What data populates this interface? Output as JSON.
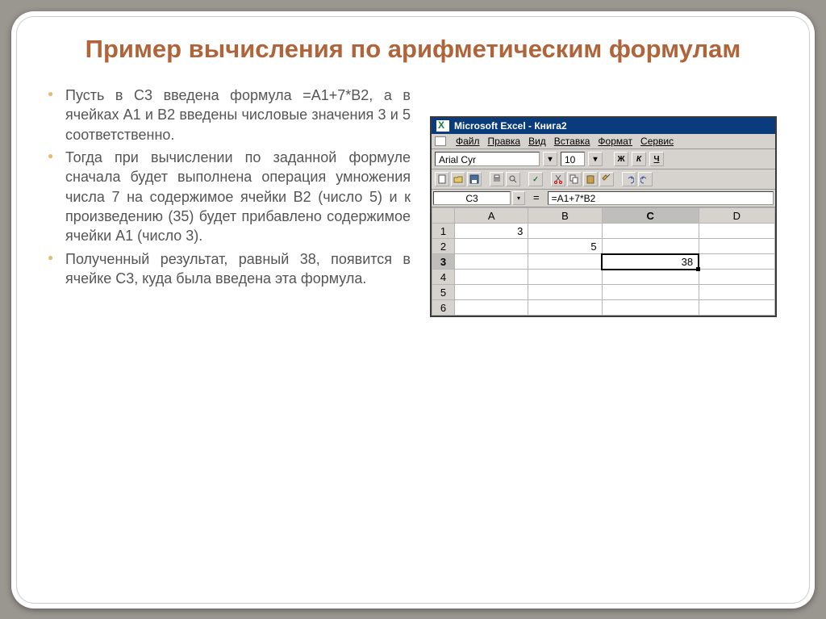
{
  "title": "Пример вычисления по арифметическим формулам",
  "bullets": [
    "Пусть в С3 введена формула =А1+7*В2, а в ячейках А1 и В2 введены числовые значения 3 и 5 соответственно.",
    "Тогда при вычислении по заданной формуле сначала будет выполнена операция умножения числа 7 на содержимое ячейки В2 (число 5) и к произведению (35) будет прибавлено содержимое ячейки А1 (число 3).",
    "Полученный результат, равный 38, появится в ячейке С3, куда была введена эта формула."
  ],
  "excel": {
    "app_title": "Microsoft Excel - Книга2",
    "menus": [
      "Файл",
      "Правка",
      "Вид",
      "Вставка",
      "Формат",
      "Сервис"
    ],
    "font_name": "Arial Cyr",
    "font_size": "10",
    "bold": "Ж",
    "italic": "К",
    "underline": "Ч",
    "name_box": "C3",
    "equals": "=",
    "formula": "=A1+7*B2",
    "columns": [
      "A",
      "B",
      "C",
      "D"
    ],
    "rows": [
      "1",
      "2",
      "3",
      "4",
      "5",
      "6"
    ],
    "cells": {
      "A1": "3",
      "B2": "5",
      "C3": "38"
    },
    "selected": "C3"
  },
  "chart_data": {
    "type": "table",
    "title": "Excel spreadsheet cells",
    "columns": [
      "A",
      "B",
      "C",
      "D"
    ],
    "rows": [
      {
        "row": 1,
        "A": 3,
        "B": null,
        "C": null,
        "D": null
      },
      {
        "row": 2,
        "A": null,
        "B": 5,
        "C": null,
        "D": null
      },
      {
        "row": 3,
        "A": null,
        "B": null,
        "C": 38,
        "D": null
      },
      {
        "row": 4,
        "A": null,
        "B": null,
        "C": null,
        "D": null
      },
      {
        "row": 5,
        "A": null,
        "B": null,
        "C": null,
        "D": null
      },
      {
        "row": 6,
        "A": null,
        "B": null,
        "C": null,
        "D": null
      }
    ],
    "formula_cell": "C3",
    "formula": "=A1+7*B2"
  }
}
